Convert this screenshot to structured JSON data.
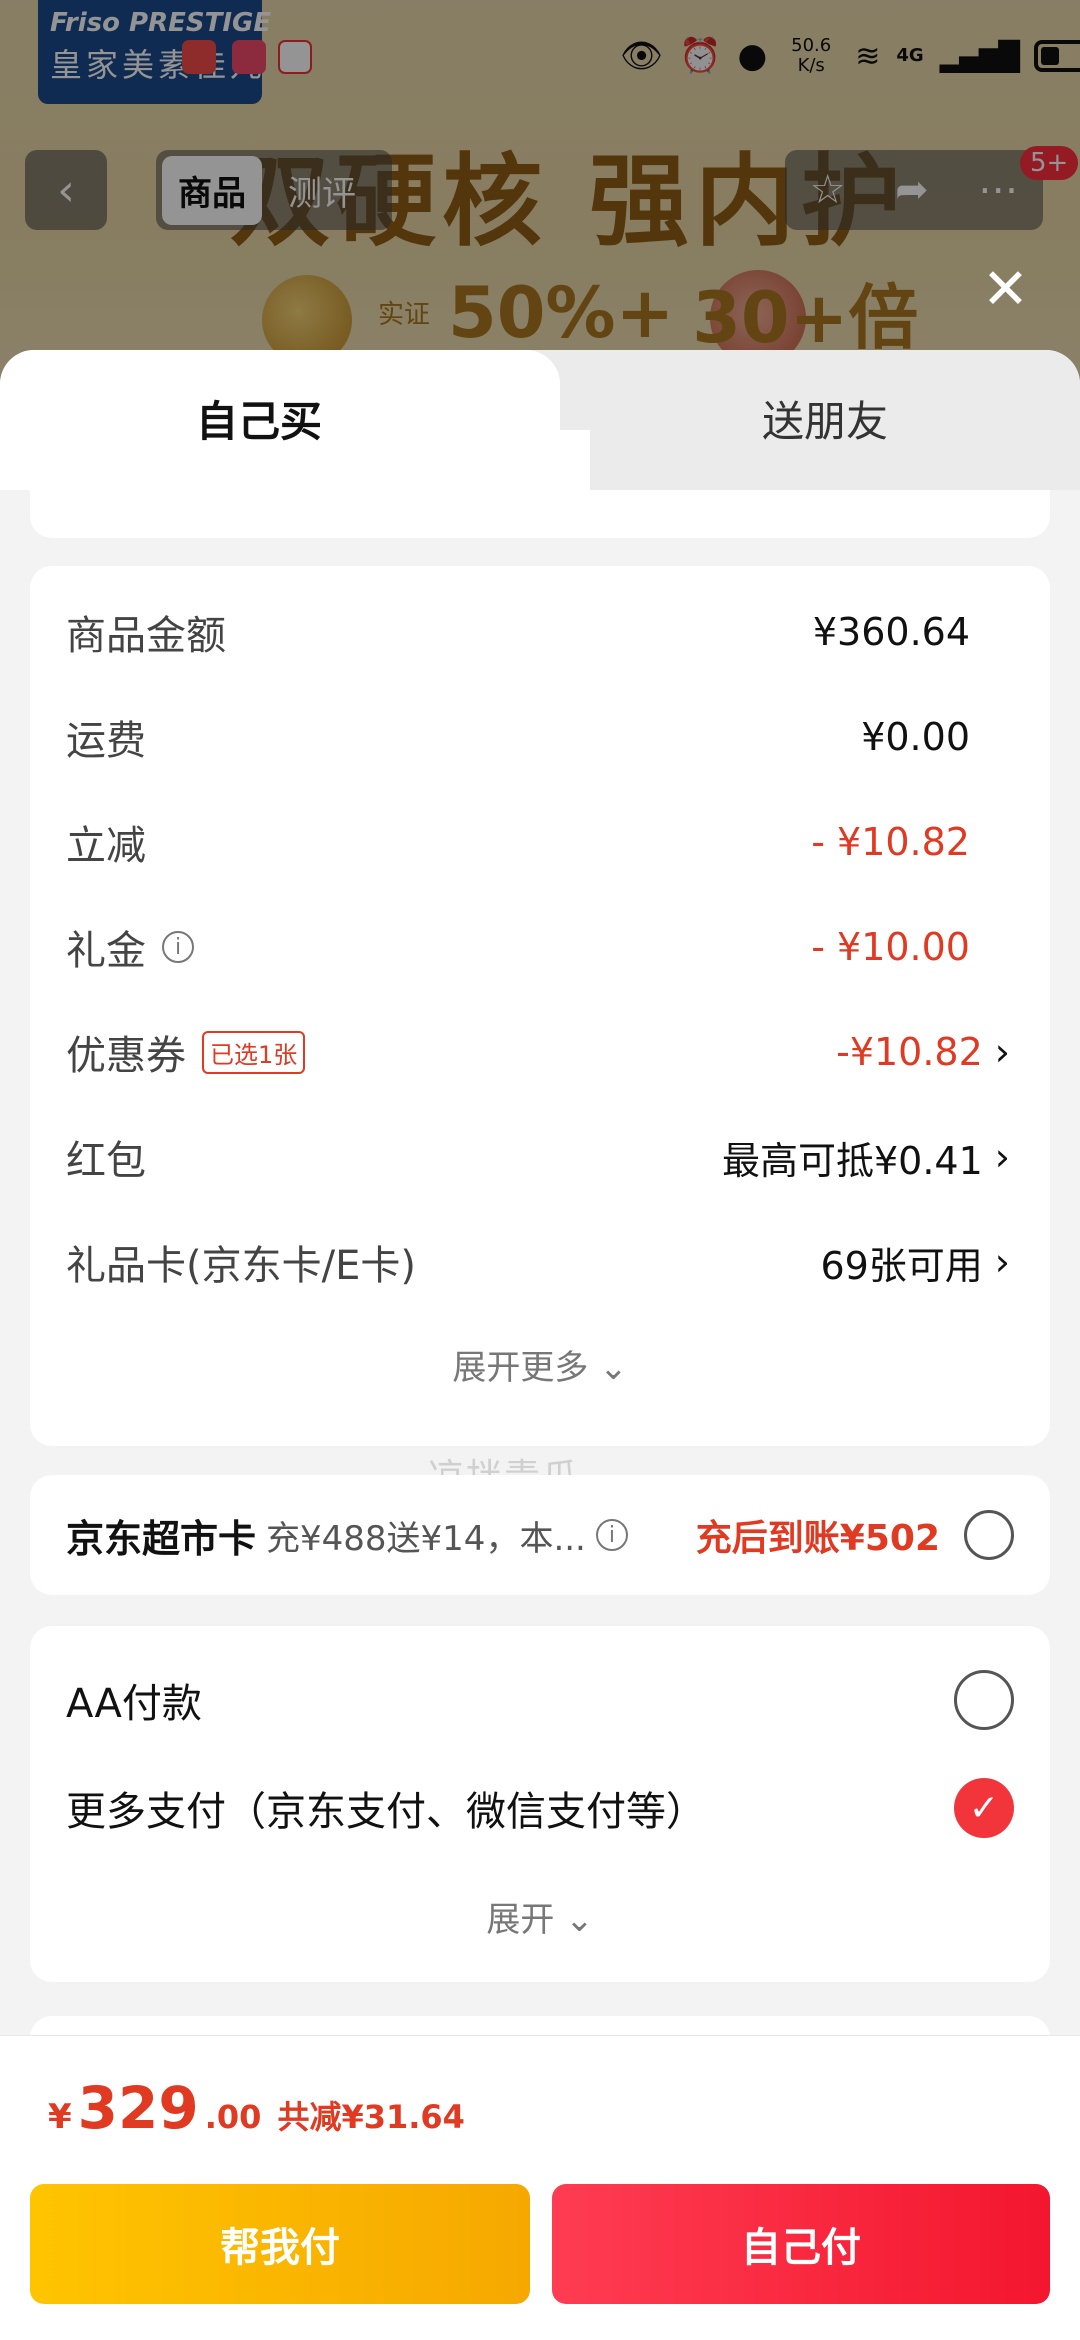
{
  "background": {
    "logo_line1": "Friso PRESTIGE",
    "logo_line2": "皇家美素佳儿",
    "banner_text": "双硬核 强内护",
    "stat1_prefix": "实证",
    "stat1_value": "50%+",
    "stat2_value": "30+倍"
  },
  "status_bar": {
    "network_speed": "50.6 K/s",
    "network_type": "4G",
    "icons": [
      "eye-icon",
      "alarm-icon",
      "location-icon",
      "wifi-icon",
      "signal-icon",
      "battery-icon"
    ]
  },
  "top_nav": {
    "back_icon": "back-arrow-icon",
    "tabs": [
      {
        "label": "商品",
        "active": true
      },
      {
        "label": "测评",
        "active": false
      }
    ],
    "actions": [
      "star-icon",
      "share-icon",
      "more-icon"
    ],
    "badge": "5+"
  },
  "sheet": {
    "tabs": [
      {
        "label": "自己买",
        "active": true
      },
      {
        "label": "送朋友",
        "active": false
      }
    ],
    "price_rows": [
      {
        "label": "商品金额",
        "value": "¥360.64"
      },
      {
        "label": "运费",
        "value": "¥0.00"
      },
      {
        "label": "立减",
        "value": "- ¥10.82"
      },
      {
        "label": "礼金",
        "value": "- ¥10.00"
      },
      {
        "label": "优惠券",
        "tag": "已选1张",
        "value": "-¥10.82"
      },
      {
        "label": "红包",
        "value": "最高可抵¥0.41"
      },
      {
        "label": "礼品卡(京东卡/E卡)",
        "value": "69张可用"
      }
    ],
    "expand_more": "展开更多",
    "supermarket_card": {
      "title": "京东超市卡",
      "desc": "充¥488送¥14，本...",
      "arrival": "充后到账¥502"
    },
    "payment_options": [
      {
        "label": "AA付款",
        "checked": false
      },
      {
        "label": "更多支付（京东支付、微信支付等）",
        "checked": true
      }
    ],
    "expand": "展开",
    "watermark": "凉拌青瓜"
  },
  "bottom_bar": {
    "currency": "¥",
    "total_int": "329",
    "total_dec": ".00",
    "saved": "共减¥31.64",
    "help_pay_label": "帮我付",
    "self_pay_label": "自己付"
  },
  "colors": {
    "accent_red": "#e13a22",
    "button_yellow": "#ffc400",
    "button_red": "#f3162e"
  }
}
